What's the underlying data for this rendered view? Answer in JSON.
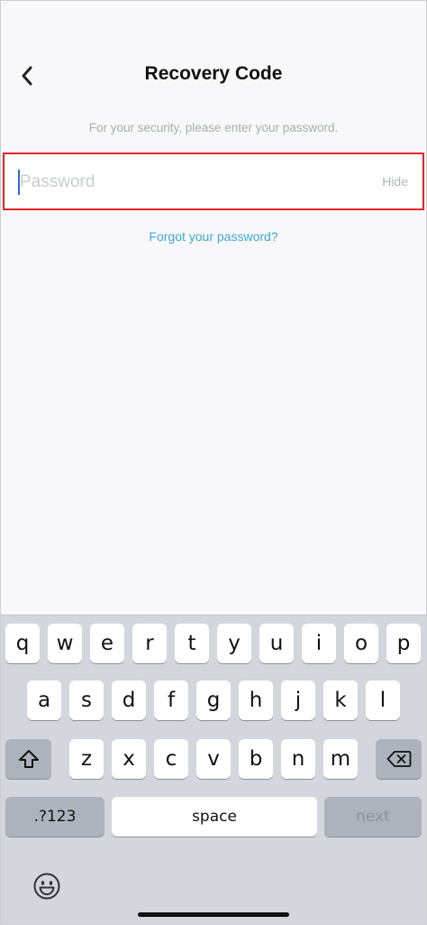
{
  "header": {
    "title": "Recovery Code"
  },
  "subtitle": "For your security, please enter your password.",
  "password_field": {
    "placeholder": "Password",
    "value": "",
    "toggle_label": "Hide"
  },
  "forgot_link": "Forgot your password?",
  "keyboard": {
    "row1": [
      "q",
      "w",
      "e",
      "r",
      "t",
      "y",
      "u",
      "i",
      "o",
      "p"
    ],
    "row2": [
      "a",
      "s",
      "d",
      "f",
      "g",
      "h",
      "j",
      "k",
      "l"
    ],
    "row3": [
      "z",
      "x",
      "c",
      "v",
      "b",
      "n",
      "m"
    ],
    "numbers_label": ".?123",
    "space_label": "space",
    "next_label": "next"
  },
  "colors": {
    "highlight_border": "#e0262b",
    "link": "#3fa7d6",
    "caret": "#2f6bd8"
  }
}
